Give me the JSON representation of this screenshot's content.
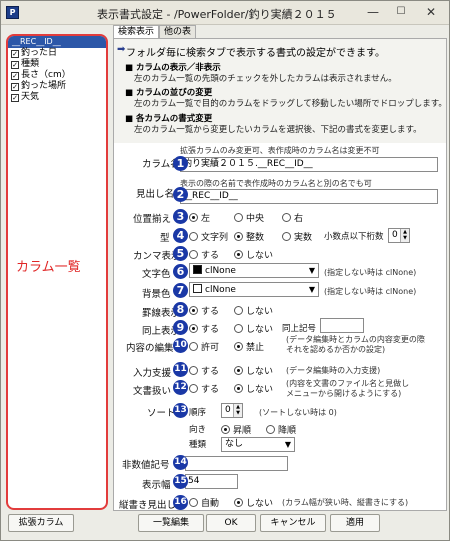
{
  "window": {
    "title": "表示書式設定 - /PowerFolder/釣り実績２０１５",
    "icon": "app-icon",
    "controls": {
      "minimize": "—",
      "maximize": "☐",
      "close": "✕"
    }
  },
  "column_list": {
    "header": "__REC__ID__",
    "items": [
      {
        "label": "釣った日",
        "checked": true
      },
      {
        "label": "種類",
        "checked": true
      },
      {
        "label": "長さ（cm）",
        "checked": true
      },
      {
        "label": "釣った場所",
        "checked": true
      },
      {
        "label": "天気",
        "checked": true
      }
    ],
    "annotation": "カラム一覧"
  },
  "tabs": [
    {
      "label": "検索表示"
    },
    {
      "label": "他の表"
    }
  ],
  "info": {
    "heading": "フォルダ毎に検索タブで表示する書式の設定ができます。",
    "sections": [
      {
        "title": "■ カラムの表示／非表示",
        "desc": "左のカラム一覧の先頭のチェックを外したカラムは表示されません。"
      },
      {
        "title": "■ カラムの並びの変更",
        "desc": "左のカラム一覧で目的のカラムをドラッグして移動したい場所でドロップします。"
      },
      {
        "title": "■ 各カラムの書式変更",
        "desc": "左のカラム一覧から変更したいカラムを選択後、下記の書式を変更します。"
      }
    ]
  },
  "form": {
    "colname": {
      "label": "カラム名",
      "hint": "拡張カラムのみ変更可、表作成時のカラム名は変更不可",
      "value": "釣り実績２０１５.__REC__ID__"
    },
    "heading": {
      "label": "見出し名",
      "hint": "表示の際の名前で表作成時のカラム名と別の名でも可",
      "value": "__REC__ID__"
    },
    "align": {
      "label": "位置揃え",
      "options": [
        "左",
        "中央",
        "右"
      ],
      "selected": 0
    },
    "type": {
      "label": "型",
      "options": [
        "文字列",
        "整数",
        "実数"
      ],
      "selected": 1,
      "decimals_label": "小数点以下桁数",
      "decimals": "0"
    },
    "comma": {
      "label": "カンマ表示",
      "options": [
        "する",
        "しない"
      ],
      "selected": 1
    },
    "fgcolor": {
      "label": "文字色",
      "value": "clNone",
      "swatch": "#000000",
      "hint": "(指定しない時は clNone)"
    },
    "bgcolor": {
      "label": "背景色",
      "value": "clNone",
      "swatch": "#ffffff",
      "hint": "(指定しない時は clNone)"
    },
    "gridline": {
      "label": "罫線表示",
      "options": [
        "する",
        "しない"
      ],
      "selected": 0
    },
    "sameval": {
      "label": "同上表示",
      "options": [
        "する",
        "しない"
      ],
      "selected": 0,
      "mark_label": "同上記号",
      "mark_value": ""
    },
    "edit": {
      "label": "内容の編集",
      "options": [
        "許可",
        "禁止"
      ],
      "selected": 1,
      "hint": "(データ編集時とカラムの内容変更の際\nそれを認めるか否かの設定)"
    },
    "input": {
      "label": "入力支援",
      "options": [
        "する",
        "しない"
      ],
      "selected": 1,
      "hint": "(データ編集時の入力支援)"
    },
    "doc": {
      "label": "文書扱い",
      "options": [
        "する",
        "しない"
      ],
      "selected": 1,
      "hint": "(内容を文書のファイル名と見做し\nメニューから開けるようにする)"
    },
    "sort": {
      "label": "ソート",
      "order_label": "順序",
      "order": "0",
      "hint": "(ソートしない時は 0)",
      "dir_label": "向き",
      "dir_options": [
        "昇順",
        "降順"
      ],
      "dir_selected": 0,
      "kind_label": "種類",
      "kind": "なし"
    },
    "nonnum": {
      "label": "非数値記号",
      "value": ""
    },
    "width": {
      "label": "表示幅",
      "value": "54"
    },
    "vertical": {
      "label": "縦書き見出し",
      "options": [
        "自動",
        "しない"
      ],
      "selected": 1,
      "hint": "(カラム幅が狭い時、縦書きにする)"
    }
  },
  "numbers": [
    "1",
    "2",
    "3",
    "4",
    "5",
    "6",
    "7",
    "8",
    "9",
    "10",
    "11",
    "12",
    "13",
    "14",
    "15",
    "16"
  ],
  "buttons": {
    "ext": "拡張カラム",
    "bulk": "一覧編集",
    "ok": "OK",
    "cancel": "キャンセル",
    "apply": "適用"
  }
}
